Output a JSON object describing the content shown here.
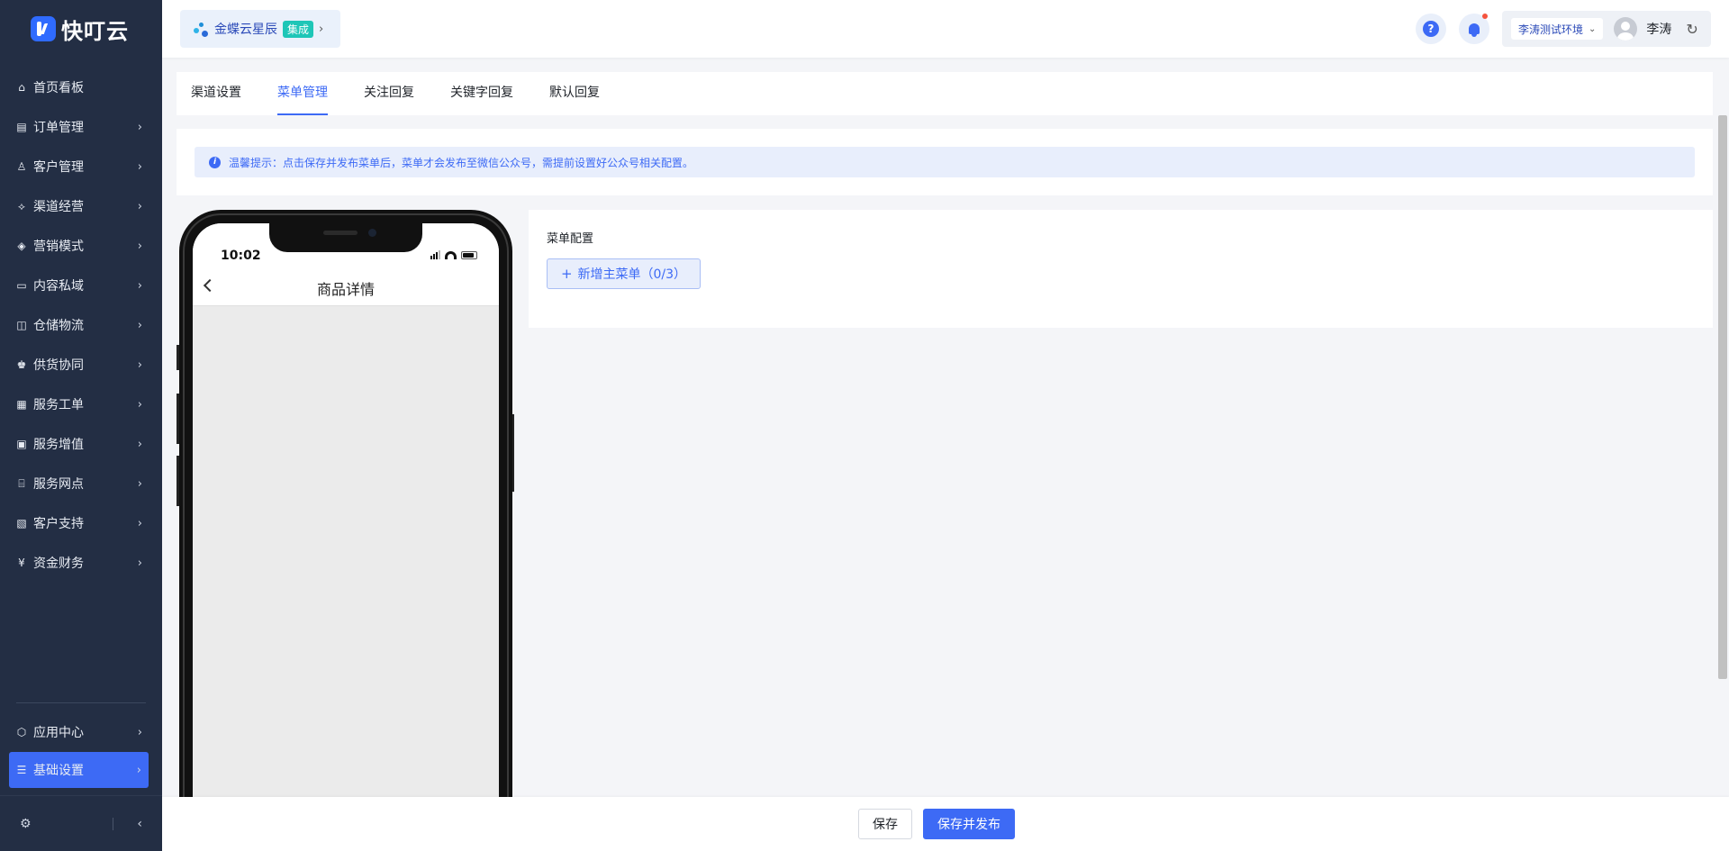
{
  "app": {
    "logo_text": "快叮云"
  },
  "sidebar": {
    "items": [
      {
        "label": "首页看板",
        "icon": "home-icon",
        "glyph": "⌂",
        "has_chevron": false
      },
      {
        "label": "订单管理",
        "icon": "clipboard-icon",
        "glyph": "▤",
        "has_chevron": true
      },
      {
        "label": "客户管理",
        "icon": "user-icon",
        "glyph": "♙",
        "has_chevron": true
      },
      {
        "label": "渠道经营",
        "icon": "network-icon",
        "glyph": "⟡",
        "has_chevron": true
      },
      {
        "label": "营销模式",
        "icon": "tag-icon",
        "glyph": "◈",
        "has_chevron": true
      },
      {
        "label": "内容私域",
        "icon": "image-icon",
        "glyph": "▭",
        "has_chevron": true
      },
      {
        "label": "仓储物流",
        "icon": "box-icon",
        "glyph": "◫",
        "has_chevron": true
      },
      {
        "label": "供货协同",
        "icon": "users-icon",
        "glyph": "♚",
        "has_chevron": true
      },
      {
        "label": "服务工单",
        "icon": "ticket-icon",
        "glyph": "▦",
        "has_chevron": true
      },
      {
        "label": "服务增值",
        "icon": "bag-icon",
        "glyph": "▣",
        "has_chevron": true
      },
      {
        "label": "服务网点",
        "icon": "store-icon",
        "glyph": "⌸",
        "has_chevron": true
      },
      {
        "label": "客户支持",
        "icon": "support-icon",
        "glyph": "▧",
        "has_chevron": true
      },
      {
        "label": "资金财务",
        "icon": "yuan-icon",
        "glyph": "¥",
        "has_chevron": true
      }
    ],
    "bottom_items": [
      {
        "label": "应用中心",
        "icon": "cube-icon",
        "glyph": "⬡"
      },
      {
        "label": "基础设置",
        "icon": "sliders-icon",
        "glyph": "☰"
      }
    ]
  },
  "header": {
    "brand_chip": {
      "name": "金蝶云星辰",
      "badge": "集成"
    },
    "environment": "李涛测试环境",
    "user_name": "李涛"
  },
  "tabs": [
    {
      "label": "渠道设置",
      "active": false
    },
    {
      "label": "菜单管理",
      "active": true
    },
    {
      "label": "关注回复",
      "active": false
    },
    {
      "label": "关键字回复",
      "active": false
    },
    {
      "label": "默认回复",
      "active": false
    }
  ],
  "notice": {
    "text": "温馨提示：点击保存并发布菜单后，菜单才会发布至微信公众号，需提前设置好公众号相关配置。"
  },
  "phone": {
    "time": "10:02",
    "title": "商品详情"
  },
  "config": {
    "title": "菜单配置",
    "add_button": "新增主菜单（0/3）"
  },
  "footer": {
    "save": "保存",
    "save_publish": "保存并发布"
  },
  "colors": {
    "primary": "#3d6af5",
    "sidebar_bg": "#232e44",
    "badge": "#1ec6b7",
    "notify": "#f5533d"
  }
}
